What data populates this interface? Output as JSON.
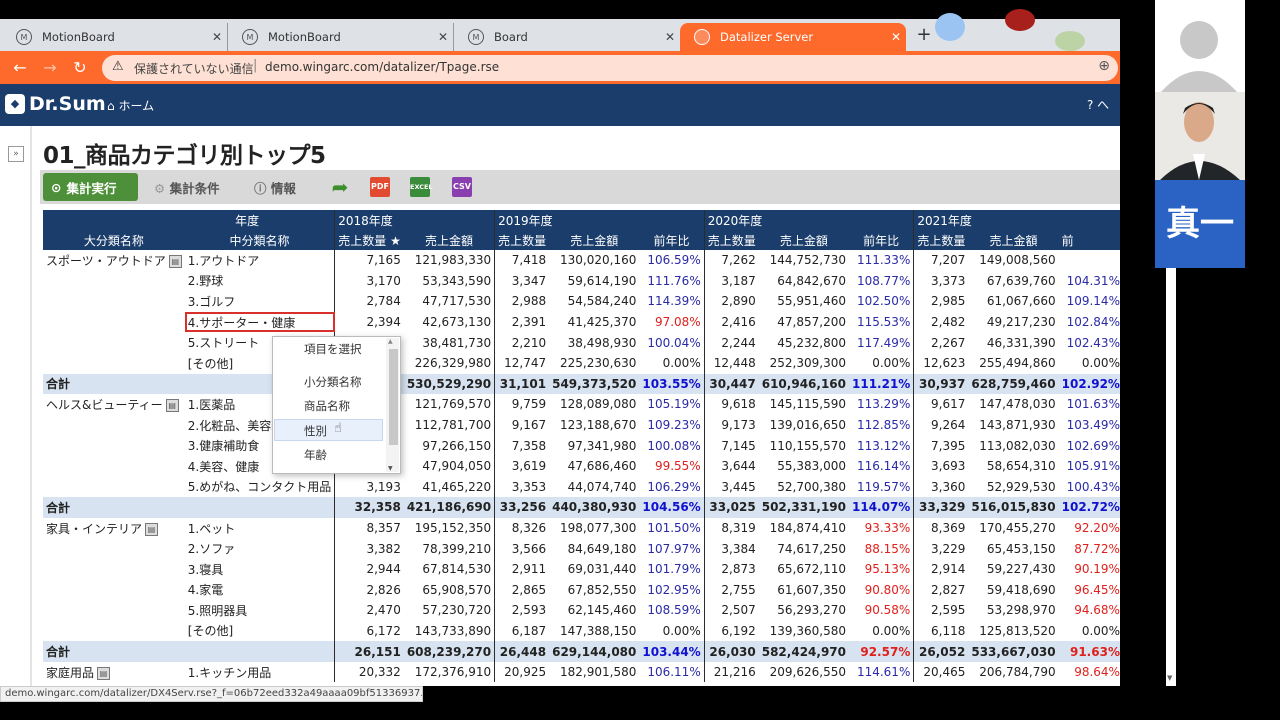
{
  "browser": {
    "tabs": [
      {
        "label": "MotionBoard",
        "close": "✕"
      },
      {
        "label": "MotionBoard",
        "close": "✕"
      },
      {
        "label": "Board",
        "close": "✕"
      },
      {
        "label": "Datalizer Server",
        "close": "✕"
      }
    ],
    "new_tab": "+",
    "security_label": "保護されていない通信",
    "url": "demo.wingarc.com/datalizer/Tpage.rse",
    "accent": "#fd6a2c"
  },
  "app": {
    "logo": "Dr.Sum",
    "home": "ホーム",
    "help": "? へ"
  },
  "page": {
    "title": "01_商品カテゴリ別トップ5"
  },
  "toolbar": {
    "run": "集計実行",
    "conditions": "集計条件",
    "info": "情報",
    "pdf": "PDF",
    "excel": "EXCEL",
    "csv": "CSV"
  },
  "table": {
    "corner_top": "年度",
    "corner_left": "大分類名称",
    "corner_right": "中分類名称",
    "years": [
      "2018年度",
      "2019年度",
      "2020年度",
      "2021年度"
    ],
    "cols": {
      "qty": "売上数量",
      "amt": "売上金額",
      "ratio": "前年比",
      "partial": "前"
    },
    "rows": [
      {
        "cat": "スポーツ・アウトドア",
        "sub": "1.アウトドア",
        "v": [
          "7,165",
          "121,983,330",
          "7,418",
          "130,020,160",
          "106.59%",
          "7,262",
          "144,752,730",
          "111.33%",
          "7,207",
          "149,008,560",
          ""
        ],
        "r": [
          "p",
          "p",
          "p"
        ]
      },
      {
        "cat": "",
        "sub": "2.野球",
        "v": [
          "3,170",
          "53,343,590",
          "3,347",
          "59,614,190",
          "111.76%",
          "3,187",
          "64,842,670",
          "108.77%",
          "3,373",
          "67,639,760",
          "104.31%"
        ],
        "r": [
          "p",
          "p",
          "p"
        ]
      },
      {
        "cat": "",
        "sub": "3.ゴルフ",
        "v": [
          "2,784",
          "47,717,530",
          "2,988",
          "54,584,240",
          "114.39%",
          "2,890",
          "55,951,460",
          "102.50%",
          "2,985",
          "61,067,660",
          "109.14%"
        ],
        "r": [
          "p",
          "p",
          "p"
        ]
      },
      {
        "cat": "",
        "sub": "4.サポーター・健康",
        "v": [
          "2,394",
          "42,673,130",
          "2,391",
          "41,425,370",
          "97.08%",
          "2,416",
          "47,857,200",
          "115.53%",
          "2,482",
          "49,217,230",
          "102.84%"
        ],
        "r": [
          "n",
          "p",
          "p"
        ]
      },
      {
        "cat": "",
        "sub": "5.ストリート",
        "v": [
          "",
          "38,481,730",
          "2,210",
          "38,498,930",
          "100.04%",
          "2,244",
          "45,232,800",
          "117.49%",
          "2,267",
          "46,331,390",
          "102.43%"
        ],
        "r": [
          "p",
          "p",
          "p"
        ]
      },
      {
        "cat": "",
        "sub": "[その他]",
        "v": [
          "",
          "226,329,980",
          "12,747",
          "225,230,630",
          "0.00%",
          "12,448",
          "252,309,300",
          "0.00%",
          "12,623",
          "255,494,860",
          "0.00%"
        ],
        "r": [
          "k",
          "k",
          "k"
        ]
      },
      {
        "total": true,
        "cat": "合計",
        "sub": "",
        "v": [
          "",
          "530,529,290",
          "31,101",
          "549,373,520",
          "103.55%",
          "30,447",
          "610,946,160",
          "111.21%",
          "30,937",
          "628,759,460",
          "102.92%"
        ],
        "r": [
          "p",
          "p",
          "p"
        ]
      },
      {
        "cat": "ヘルス&ビューティー",
        "sub": "1.医薬品",
        "v": [
          "",
          "121,769,570",
          "9,759",
          "128,089,080",
          "105.19%",
          "9,618",
          "145,115,590",
          "113.29%",
          "9,617",
          "147,478,030",
          "101.63%"
        ],
        "r": [
          "p",
          "p",
          "p"
        ]
      },
      {
        "cat": "",
        "sub": "2.化粧品、美容雑",
        "v": [
          "",
          "112,781,700",
          "9,167",
          "123,188,670",
          "109.23%",
          "9,173",
          "139,016,650",
          "112.85%",
          "9,264",
          "143,871,930",
          "103.49%"
        ],
        "r": [
          "p",
          "p",
          "p"
        ]
      },
      {
        "cat": "",
        "sub": "3.健康補助食",
        "v": [
          "",
          "97,266,150",
          "7,358",
          "97,341,980",
          "100.08%",
          "7,145",
          "110,155,570",
          "113.12%",
          "7,395",
          "113,082,030",
          "102.69%"
        ],
        "r": [
          "p",
          "p",
          "p"
        ]
      },
      {
        "cat": "",
        "sub": "4.美容、健康",
        "v": [
          "",
          "47,904,050",
          "3,619",
          "47,686,460",
          "99.55%",
          "3,644",
          "55,383,000",
          "116.14%",
          "3,693",
          "58,654,310",
          "105.91%"
        ],
        "r": [
          "n",
          "p",
          "p"
        ]
      },
      {
        "cat": "",
        "sub": "5.めがね、コンタクト用品",
        "v": [
          "3,193",
          "41,465,220",
          "3,353",
          "44,074,740",
          "106.29%",
          "3,445",
          "52,700,380",
          "119.57%",
          "3,360",
          "52,929,530",
          "100.43%"
        ],
        "r": [
          "p",
          "p",
          "p"
        ]
      },
      {
        "total": true,
        "cat": "合計",
        "sub": "",
        "v": [
          "32,358",
          "421,186,690",
          "33,256",
          "440,380,930",
          "104.56%",
          "33,025",
          "502,331,190",
          "114.07%",
          "33,329",
          "516,015,830",
          "102.72%"
        ],
        "r": [
          "p",
          "p",
          "p"
        ]
      },
      {
        "cat": "家具・インテリア",
        "sub": "1.ペット",
        "v": [
          "8,357",
          "195,152,350",
          "8,326",
          "198,077,300",
          "101.50%",
          "8,319",
          "184,874,410",
          "93.33%",
          "8,369",
          "170,455,270",
          "92.20%"
        ],
        "r": [
          "p",
          "n",
          "n"
        ]
      },
      {
        "cat": "",
        "sub": "2.ソファ",
        "v": [
          "3,382",
          "78,399,210",
          "3,566",
          "84,649,180",
          "107.97%",
          "3,384",
          "74,617,250",
          "88.15%",
          "3,229",
          "65,453,150",
          "87.72%"
        ],
        "r": [
          "p",
          "n",
          "n"
        ]
      },
      {
        "cat": "",
        "sub": "3.寝具",
        "v": [
          "2,944",
          "67,814,530",
          "2,911",
          "69,031,440",
          "101.79%",
          "2,873",
          "65,672,110",
          "95.13%",
          "2,914",
          "59,227,430",
          "90.19%"
        ],
        "r": [
          "p",
          "n",
          "n"
        ]
      },
      {
        "cat": "",
        "sub": "4.家電",
        "v": [
          "2,826",
          "65,908,570",
          "2,865",
          "67,852,550",
          "102.95%",
          "2,755",
          "61,607,350",
          "90.80%",
          "2,827",
          "59,418,690",
          "96.45%"
        ],
        "r": [
          "p",
          "n",
          "n"
        ]
      },
      {
        "cat": "",
        "sub": "5.照明器具",
        "v": [
          "2,470",
          "57,230,720",
          "2,593",
          "62,145,460",
          "108.59%",
          "2,507",
          "56,293,270",
          "90.58%",
          "2,595",
          "53,298,970",
          "94.68%"
        ],
        "r": [
          "p",
          "n",
          "n"
        ]
      },
      {
        "cat": "",
        "sub": "[その他]",
        "v": [
          "6,172",
          "143,733,890",
          "6,187",
          "147,388,150",
          "0.00%",
          "6,192",
          "139,360,580",
          "0.00%",
          "6,118",
          "125,813,520",
          "0.00%"
        ],
        "r": [
          "k",
          "k",
          "k"
        ]
      },
      {
        "total": true,
        "cat": "合計",
        "sub": "",
        "v": [
          "26,151",
          "608,239,270",
          "26,448",
          "629,144,080",
          "103.44%",
          "26,030",
          "582,424,970",
          "92.57%",
          "26,052",
          "533,667,030",
          "91.63%"
        ],
        "r": [
          "p",
          "n",
          "n"
        ]
      },
      {
        "cat": "家庭用品",
        "sub": "1.キッチン用品",
        "v": [
          "20,332",
          "172,376,910",
          "20,925",
          "182,901,580",
          "106.11%",
          "21,216",
          "209,626,550",
          "114.61%",
          "20,465",
          "206,784,790",
          "98.64%"
        ],
        "r": [
          "p",
          "p",
          "n"
        ]
      }
    ]
  },
  "popup": {
    "header": "項目を選択",
    "items": [
      "小分類名称",
      "商品名称",
      "性別",
      "年齢"
    ],
    "selected": "性別"
  },
  "status_url": "demo.wingarc.com/datalizer/DX4Serv.rse?_f=06b72eed332a49aaaa09bf51336937...",
  "participant": {
    "name": "真一"
  }
}
